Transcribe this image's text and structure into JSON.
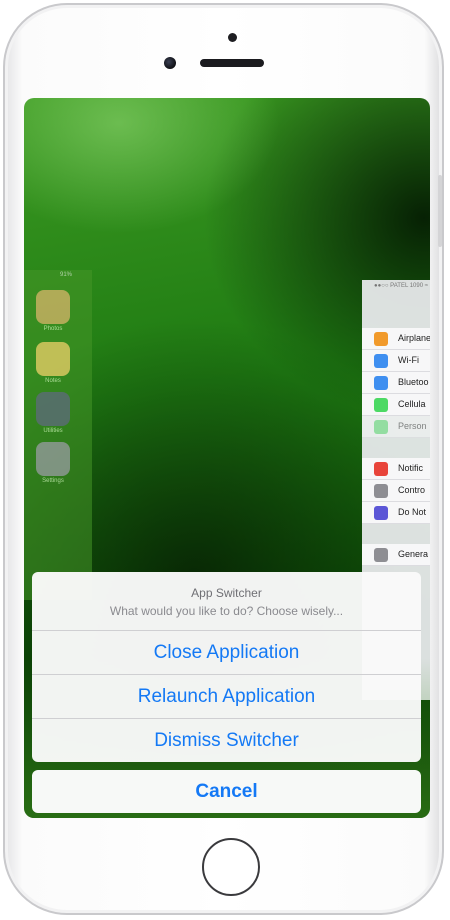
{
  "phone": {
    "colors": {
      "frame": "#ffffff",
      "screen_accent": "#1e7a12"
    }
  },
  "switcher_cards": {
    "left_card": {
      "status_text": "91%",
      "apps": [
        {
          "label": "Photos",
          "icon": "photos-icon",
          "color": "#e0c27a"
        },
        {
          "label": "Notes",
          "icon": "notes-icon",
          "color": "#f2d26a"
        },
        {
          "label": "Utilities",
          "icon": "utilities-folder-icon",
          "color": "#6e7a8c"
        },
        {
          "label": "Settings",
          "icon": "settings-gear-icon",
          "color": "#9a9ca3"
        }
      ]
    },
    "right_card": {
      "status_text": "●●○○ PATEL 1090 ≈",
      "rows": [
        {
          "label": "Airplane",
          "icon": "airplane-icon",
          "color": "#f19a2b"
        },
        {
          "label": "Wi-Fi",
          "icon": "wifi-icon",
          "color": "#3f8ff0"
        },
        {
          "label": "Bluetoo",
          "icon": "bluetooth-icon",
          "color": "#3f8ff0"
        },
        {
          "label": "Cellula",
          "icon": "cellular-icon",
          "color": "#4cd964"
        },
        {
          "label": "Person",
          "icon": "personal-hotspot-icon",
          "color": "#4cd964"
        },
        {
          "label": "Notific",
          "icon": "notifications-icon",
          "color": "#e8443a"
        },
        {
          "label": "Contro",
          "icon": "control-center-icon",
          "color": "#8e8e93"
        },
        {
          "label": "Do Not",
          "icon": "do-not-disturb-icon",
          "color": "#5b56d6"
        },
        {
          "label": "Genera",
          "icon": "general-gear-icon",
          "color": "#8e8e93"
        }
      ]
    }
  },
  "action_sheet": {
    "title": "App Switcher",
    "message": "What would you like to do? Choose wisely...",
    "buttons": [
      {
        "label": "Close Application"
      },
      {
        "label": "Relaunch Application"
      },
      {
        "label": "Dismiss Switcher"
      }
    ],
    "cancel_label": "Cancel",
    "accent_color": "#1479f5"
  }
}
